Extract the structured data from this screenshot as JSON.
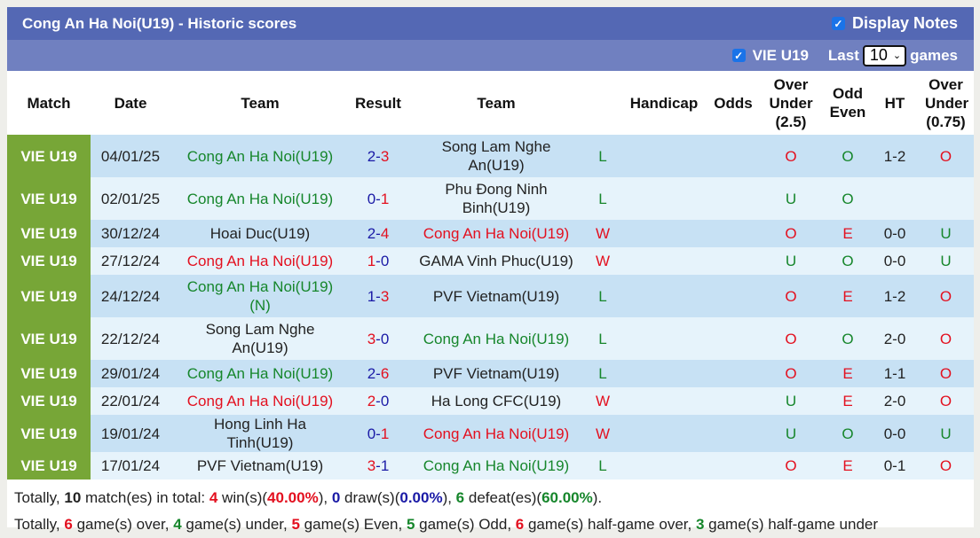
{
  "header": {
    "title": "Cong An Ha Noi(U19) - Historic scores",
    "display_notes_label": "Display Notes",
    "display_notes_checked": true
  },
  "filter": {
    "league_label": "VIE U19",
    "league_checked": true,
    "last_label": "Last",
    "games_count": "10",
    "games_label": "games"
  },
  "columns": [
    "Match",
    "Date",
    "Team",
    "Result",
    "Team",
    "Handicap",
    "Odds",
    "Over Under (2.5)",
    "Odd Even",
    "HT",
    "Over Under (0.75)"
  ],
  "colors": {
    "green": "#16862b",
    "red": "#e3101f",
    "blue": "#1a1aa6",
    "league_bg": "#77a637",
    "row_dark": "#c7e1f4",
    "row_light": "#e6f3fb",
    "title_bg": "#5468b4",
    "filter_bg": "#7080c0"
  },
  "rows": [
    {
      "league": "VIE U19",
      "date": "04/01/25",
      "home": "Cong An Ha Noi(U19)",
      "home_color": "green",
      "score_home": "2",
      "score_away": "3",
      "score_home_color": "blue",
      "score_away_color": "red",
      "away": "Song Lam Nghe An(U19)",
      "away_color": "black",
      "result": "L",
      "handicap": "",
      "odds": "",
      "ou": "O",
      "oe": "O",
      "ht": "1-2",
      "ou075": "O"
    },
    {
      "league": "VIE U19",
      "date": "02/01/25",
      "home": "Cong An Ha Noi(U19)",
      "home_color": "green",
      "score_home": "0",
      "score_away": "1",
      "score_home_color": "blue",
      "score_away_color": "red",
      "away": "Phu Đong Ninh Binh(U19)",
      "away_color": "black",
      "result": "L",
      "handicap": "",
      "odds": "",
      "ou": "U",
      "oe": "O",
      "ht": "",
      "ou075": ""
    },
    {
      "league": "VIE U19",
      "date": "30/12/24",
      "home": "Hoai Duc(U19)",
      "home_color": "black",
      "score_home": "2",
      "score_away": "4",
      "score_home_color": "blue",
      "score_away_color": "red",
      "away": "Cong An Ha Noi(U19)",
      "away_color": "red",
      "result": "W",
      "handicap": "",
      "odds": "",
      "ou": "O",
      "oe": "E",
      "ht": "0-0",
      "ou075": "U"
    },
    {
      "league": "VIE U19",
      "date": "27/12/24",
      "home": "Cong An Ha Noi(U19)",
      "home_color": "red",
      "score_home": "1",
      "score_away": "0",
      "score_home_color": "red",
      "score_away_color": "blue",
      "away": "GAMA Vinh Phuc(U19)",
      "away_color": "black",
      "result": "W",
      "handicap": "",
      "odds": "",
      "ou": "U",
      "oe": "O",
      "ht": "0-0",
      "ou075": "U"
    },
    {
      "league": "VIE U19",
      "date": "24/12/24",
      "home": "Cong An Ha Noi(U19) (N)",
      "home_color": "green",
      "score_home": "1",
      "score_away": "3",
      "score_home_color": "blue",
      "score_away_color": "red",
      "away": "PVF Vietnam(U19)",
      "away_color": "black",
      "result": "L",
      "handicap": "",
      "odds": "",
      "ou": "O",
      "oe": "E",
      "ht": "1-2",
      "ou075": "O"
    },
    {
      "league": "VIE U19",
      "date": "22/12/24",
      "home": "Song Lam Nghe An(U19)",
      "home_color": "black",
      "score_home": "3",
      "score_away": "0",
      "score_home_color": "red",
      "score_away_color": "blue",
      "away": "Cong An Ha Noi(U19)",
      "away_color": "green",
      "result": "L",
      "handicap": "",
      "odds": "",
      "ou": "O",
      "oe": "O",
      "ht": "2-0",
      "ou075": "O"
    },
    {
      "league": "VIE U19",
      "date": "29/01/24",
      "home": "Cong An Ha Noi(U19)",
      "home_color": "green",
      "score_home": "2",
      "score_away": "6",
      "score_home_color": "blue",
      "score_away_color": "red",
      "away": "PVF Vietnam(U19)",
      "away_color": "black",
      "result": "L",
      "handicap": "",
      "odds": "",
      "ou": "O",
      "oe": "E",
      "ht": "1-1",
      "ou075": "O"
    },
    {
      "league": "VIE U19",
      "date": "22/01/24",
      "home": "Cong An Ha Noi(U19)",
      "home_color": "red",
      "score_home": "2",
      "score_away": "0",
      "score_home_color": "red",
      "score_away_color": "blue",
      "away": "Ha Long CFC(U19)",
      "away_color": "black",
      "result": "W",
      "handicap": "",
      "odds": "",
      "ou": "U",
      "oe": "E",
      "ht": "2-0",
      "ou075": "O"
    },
    {
      "league": "VIE U19",
      "date": "19/01/24",
      "home": "Hong Linh Ha Tinh(U19)",
      "home_color": "black",
      "score_home": "0",
      "score_away": "1",
      "score_home_color": "blue",
      "score_away_color": "red",
      "away": "Cong An Ha Noi(U19)",
      "away_color": "red",
      "result": "W",
      "handicap": "",
      "odds": "",
      "ou": "U",
      "oe": "O",
      "ht": "0-0",
      "ou075": "U"
    },
    {
      "league": "VIE U19",
      "date": "17/01/24",
      "home": "PVF Vietnam(U19)",
      "home_color": "black",
      "score_home": "3",
      "score_away": "1",
      "score_home_color": "red",
      "score_away_color": "blue",
      "away": "Cong An Ha Noi(U19)",
      "away_color": "green",
      "result": "L",
      "handicap": "",
      "odds": "",
      "ou": "O",
      "oe": "E",
      "ht": "0-1",
      "ou075": "O"
    }
  ],
  "summary": {
    "line1": [
      {
        "t": "Totally, ",
        "c": ""
      },
      {
        "t": "10",
        "c": "bold"
      },
      {
        "t": " match(es) in total: ",
        "c": ""
      },
      {
        "t": "4",
        "c": "red"
      },
      {
        "t": " win(s)(",
        "c": ""
      },
      {
        "t": "40.00%",
        "c": "red"
      },
      {
        "t": "), ",
        "c": ""
      },
      {
        "t": "0",
        "c": "blue"
      },
      {
        "t": " draw(s)(",
        "c": ""
      },
      {
        "t": "0.00%",
        "c": "blue"
      },
      {
        "t": "), ",
        "c": ""
      },
      {
        "t": "6",
        "c": "green"
      },
      {
        "t": " defeat(es)(",
        "c": ""
      },
      {
        "t": "60.00%",
        "c": "green"
      },
      {
        "t": ").",
        "c": ""
      }
    ],
    "line2": [
      {
        "t": "Totally, ",
        "c": ""
      },
      {
        "t": "6",
        "c": "red"
      },
      {
        "t": " game(s) over, ",
        "c": ""
      },
      {
        "t": "4",
        "c": "green"
      },
      {
        "t": " game(s) under, ",
        "c": ""
      },
      {
        "t": "5",
        "c": "red"
      },
      {
        "t": " game(s) Even, ",
        "c": ""
      },
      {
        "t": "5",
        "c": "green"
      },
      {
        "t": " game(s) Odd, ",
        "c": ""
      },
      {
        "t": "6",
        "c": "red"
      },
      {
        "t": " game(s) half-game over, ",
        "c": ""
      },
      {
        "t": "3",
        "c": "green"
      },
      {
        "t": " game(s) half-game under",
        "c": ""
      }
    ]
  }
}
